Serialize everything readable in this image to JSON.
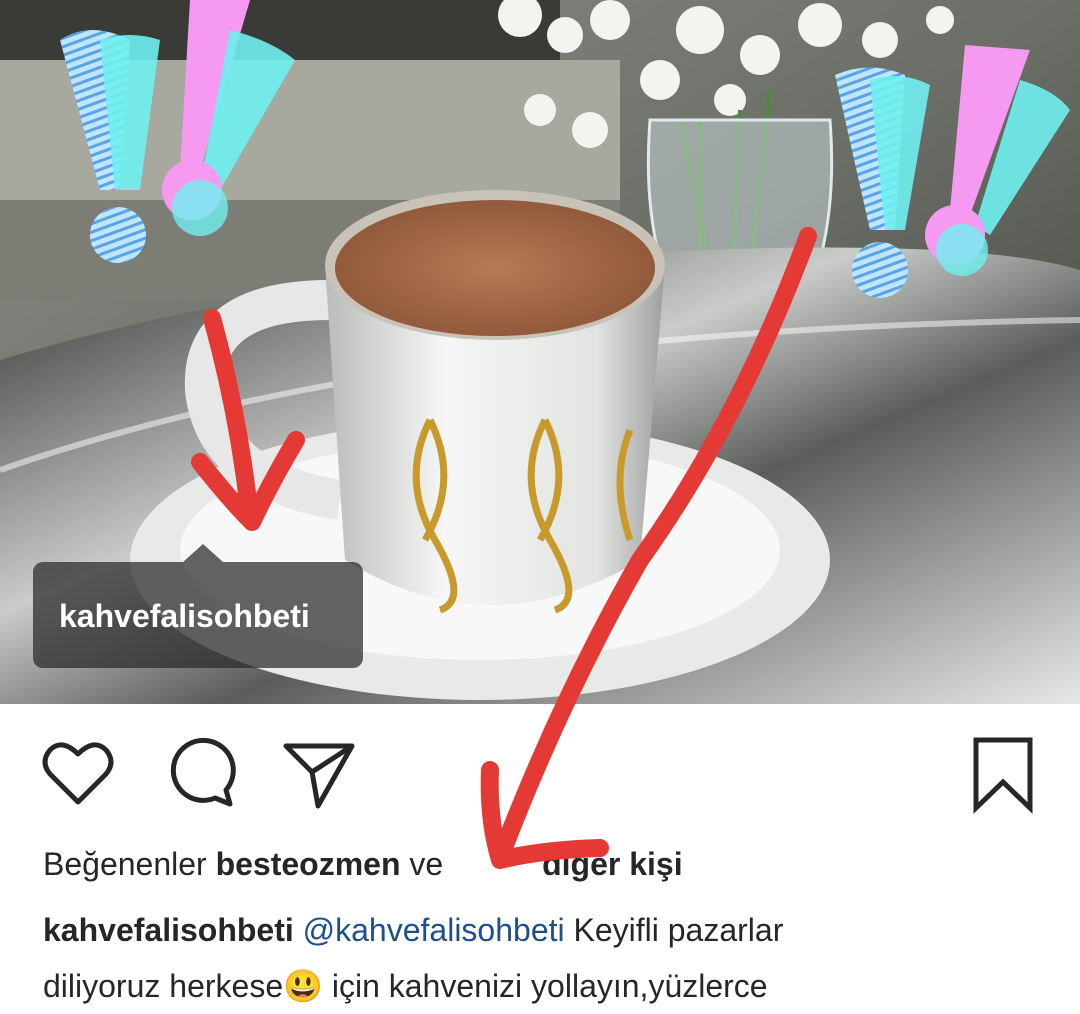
{
  "post": {
    "tag_username": "kahvefalisohbeti",
    "likes": {
      "prefix": "Beğenenler",
      "user": "besteozmen",
      "visible_fragment_1": "ve",
      "visible_fragment_2": "diğer kişi"
    },
    "caption": {
      "author": "kahvefalisohbeti",
      "mention": "@kahvefalisohbeti",
      "text_line1": "Keyifli pazarlar",
      "text_line2_a": "diliyoruz herkese",
      "emoji": "😃",
      "text_line2_b": "için kahvenizi yollayın,yüzlerce"
    }
  },
  "actions": {
    "like": "heart-icon",
    "comment": "comment-icon",
    "share": "send-icon",
    "save": "bookmark-icon"
  },
  "colors": {
    "annotation_red": "#e53935",
    "exclaim_cyan": "#6ff0f0",
    "exclaim_blue": "#5aa3e8",
    "exclaim_pink": "#f59af0",
    "coffee": "#a86a4a",
    "gold": "#c89a2c"
  }
}
